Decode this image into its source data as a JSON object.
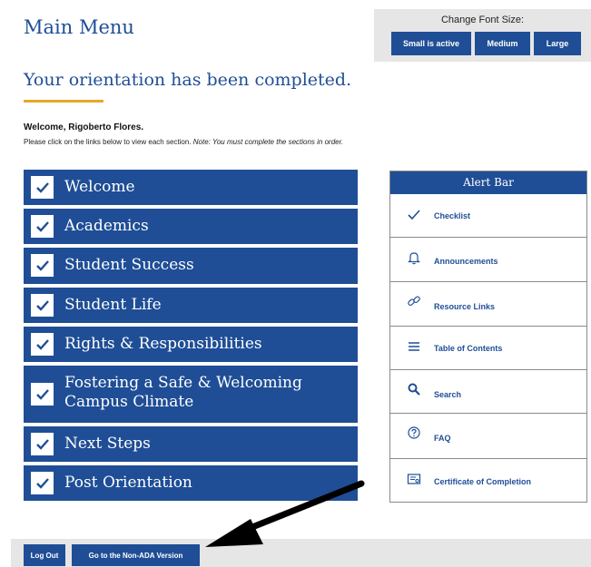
{
  "header": {
    "title": "Main Menu"
  },
  "font_size": {
    "label": "Change Font Size:",
    "small": "Small is active",
    "medium": "Medium",
    "large": "Large"
  },
  "status": {
    "completed": "Your orientation has been completed."
  },
  "welcome": "Welcome, Rigoberto Flores.",
  "instructions": {
    "text": "Please click on the links below to view each section. ",
    "note": "Note: You must complete the sections in order."
  },
  "sections": [
    {
      "label": "Welcome"
    },
    {
      "label": "Academics"
    },
    {
      "label": "Student Success"
    },
    {
      "label": "Student Life"
    },
    {
      "label": "Rights & Responsibilities"
    },
    {
      "label": "Fostering a Safe & Welcoming Campus Climate"
    },
    {
      "label": "Next Steps"
    },
    {
      "label": "Post Orientation"
    }
  ],
  "alert_bar": {
    "title": "Alert Bar",
    "items": [
      {
        "label": "Checklist",
        "icon": "checkmark-icon"
      },
      {
        "label": "Announcements",
        "icon": "bell-icon"
      },
      {
        "label": "Resource Links",
        "icon": "link-icon"
      },
      {
        "label": "Table of Contents",
        "icon": "list-icon"
      },
      {
        "label": "Search",
        "icon": "search-icon"
      },
      {
        "label": "FAQ",
        "icon": "question-icon"
      },
      {
        "label": "Certificate of Completion",
        "icon": "certificate-icon"
      }
    ]
  },
  "footer": {
    "logout": "Log Out",
    "non_ada": "Go to the Non-ADA Version"
  },
  "colors": {
    "primary": "#1f4e96",
    "accent": "#e7a726",
    "panel": "#e6e6e6"
  }
}
